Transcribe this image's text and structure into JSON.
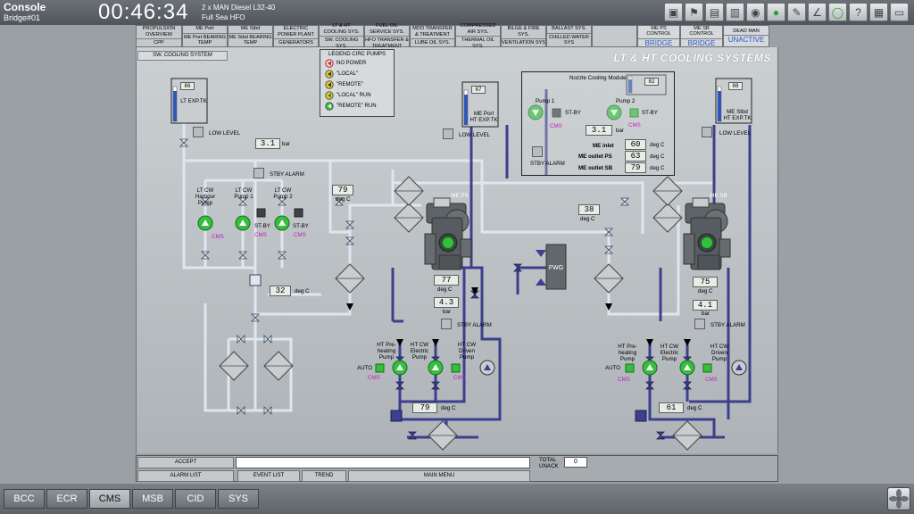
{
  "header": {
    "title": "Console",
    "station": "Bridge#01",
    "clock": "00:46:34",
    "engine": "2 x MAN Diesel L32-40",
    "fuel": "Full Sea HFO"
  },
  "menu": [
    {
      "l1": "PROPULSION",
      "l2": "OVERVIEW",
      "l3": "CPP"
    },
    {
      "l1": "ME Port",
      "l2": "",
      "l3": "ME Port BEARING TEMP"
    },
    {
      "l1": "ME Stbd",
      "l2": "",
      "l3": "ME Stbd BEARING TEMP"
    },
    {
      "l1": "ELECTRIC",
      "l2": "POWER PLANT",
      "l3": "GENERATORS"
    },
    {
      "l1": "LT & HT",
      "l2": "COOLING SYS.",
      "l3": "SW. COOLING SYS."
    },
    {
      "l1": "FUEL OIL",
      "l2": "SERVICE SYS.",
      "l3": "HFO TRANSFER & TREATMENT"
    },
    {
      "l1": "MDO TRANSFER",
      "l2": "& TREATMENT",
      "l3": "LUBE OIL SYS."
    },
    {
      "l1": "COMPRESSED",
      "l2": "AIR SYS.",
      "l3": "THERMAL OIL SYS."
    },
    {
      "l1": "BILGE & FIRE",
      "l2": "SYS.",
      "l3": "VENTILATION SYS"
    },
    {
      "l1": "BALLAST SYS.",
      "l2": "",
      "l3": "CHILLED WATER SYS"
    }
  ],
  "status": [
    {
      "label": "ME PS CONTROL",
      "value": "BRIDGE"
    },
    {
      "label": "ME SB CONTROL",
      "value": "BRIDGE"
    },
    {
      "label": "DEAD MAN",
      "value": "UNACTIVE"
    }
  ],
  "panel": {
    "sw_cooling": "SW. COOLING SYSTEM",
    "title": "LT & HT COOLING SYSTEMS"
  },
  "legend": {
    "title": "LEGEND CIRC PUMPS",
    "items": [
      "NO POWER",
      "\"LOCAL\"",
      "\"REMOTE\"",
      "\"LOCAL\"   RUN",
      "\"REMOTE\"   RUN"
    ]
  },
  "tanks": {
    "lt": {
      "label": "LT EXP.TK",
      "level": "86",
      "fill": 0.86
    },
    "port_ht": {
      "label": "ME Port HT EXP.TK",
      "level": "87",
      "fill": 0.87
    },
    "nozzle": {
      "level": "82",
      "fill": 0.82
    },
    "stbd_ht": {
      "label": "ME Stbd HT EXP.TK",
      "level": "88",
      "fill": 0.88
    }
  },
  "labels": {
    "low_level": "LOW LEVEL",
    "stby_alarm": "STBY ALARM",
    "bar": "bar",
    "degc": "deg C",
    "cms": "CMS",
    "stby": "ST-BY",
    "auto": "AUTO",
    "me_ps": "ME PS",
    "me_sb": "ME SB",
    "fwg": "FWG"
  },
  "lt": {
    "pressure": "3.1",
    "temp_out": "32",
    "pumps": [
      {
        "label": "LT CW Harbour Pump"
      },
      {
        "label": "LT CW Pump 1",
        "state": "ST-BY"
      },
      {
        "label": "LT CW Pump 2",
        "state": "ST-BY"
      }
    ]
  },
  "nozzle": {
    "title": "Nozzle Cooling Module",
    "pump1": "Pump 1",
    "pump2": "Pump 2",
    "pressure": "3.1",
    "inlet_label": "ME inlet",
    "inlet": "60",
    "outlet_ps_label": "ME outlet PS",
    "outlet_ps": "63",
    "outlet_sb_label": "ME outlet SB",
    "outlet_sb": "79"
  },
  "ps": {
    "temp_top": "79",
    "temp_out": "77",
    "pressure": "4.3",
    "temp_bottom": "79",
    "pumps": [
      "HT Pre-heating Pump",
      "HT CW Electric Pump",
      "HT CW Driven Pump"
    ]
  },
  "sb": {
    "temp_top": "38",
    "temp_out": "75",
    "pressure": "4.1",
    "temp_bottom": "61",
    "pumps": [
      "HT Pre-heating Pump",
      "HT CW Electric Pump",
      "HT CW Driven Pump"
    ]
  },
  "alarm": {
    "accept": "ACCEPT",
    "total": "TOTAL",
    "unack": "UNACK",
    "count": "0",
    "alarm_list": "ALARM LIST",
    "event_list": "EVENT LIST",
    "trend": "TREND",
    "main_menu": "MAIN MENU"
  },
  "tabs": [
    "BCC",
    "ECR",
    "CMS",
    "MSB",
    "CID",
    "SYS"
  ],
  "active_tab": "CMS",
  "colors": {
    "lt_pipe": "#dfe6ee",
    "ht_pipe": "#3b3f8e",
    "pump_green": "#34c03c",
    "readout_bg": "#e7ece5"
  }
}
